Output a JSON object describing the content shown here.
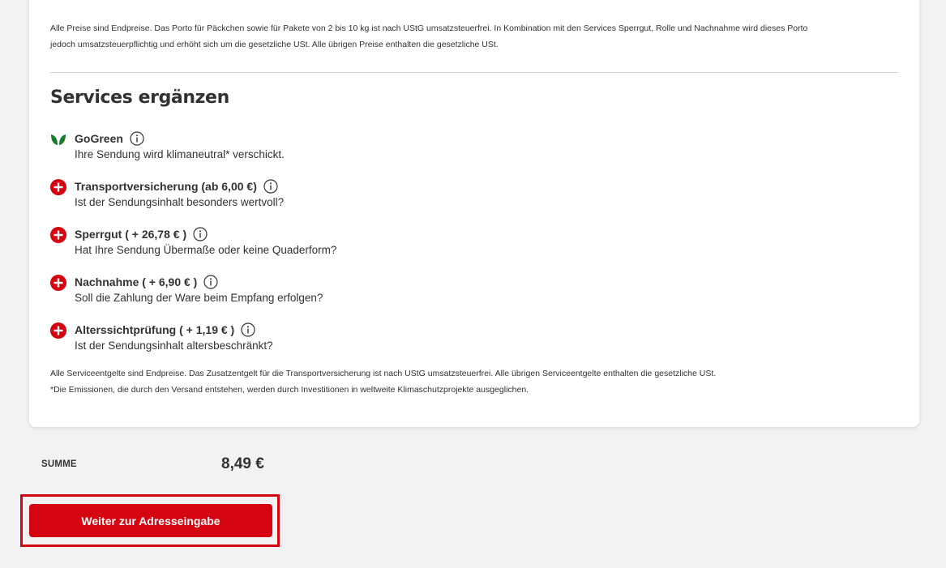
{
  "price_note": {
    "line1": "Alle Preise sind Endpreise. Das Porto für Päckchen sowie für Pakete von 2 bis 10 kg ist nach UStG umsatzsteuerfrei. In Kombination mit den Services Sperrgut, Rolle und Nachnahme wird dieses Porto",
    "line2": "jedoch umsatzsteuerpflichtig und erhöht sich um die gesetzliche USt. Alle übrigen Preise enthalten die gesetzliche USt."
  },
  "services": {
    "title": "Services ergänzen",
    "items": [
      {
        "name": "GoGreen",
        "description": "Ihre Sendung wird klimaneutral* verschickt.",
        "icon": "leaf-icon"
      },
      {
        "name": "Transportversicherung (ab 6,00 €)",
        "description": "Ist der Sendungsinhalt besonders wertvoll?",
        "icon": "plus-icon"
      },
      {
        "name": "Sperrgut ( + 26,78 € )",
        "description": "Hat Ihre Sendung Übermaße oder keine Quaderform?",
        "icon": "plus-icon"
      },
      {
        "name": "Nachnahme ( + 6,90 € )",
        "description": "Soll die Zahlung der Ware beim Empfang erfolgen?",
        "icon": "plus-icon"
      },
      {
        "name": "Alterssichtprüfung ( + 1,19 € )",
        "description": "Ist der Sendungsinhalt altersbeschränkt?",
        "icon": "plus-icon"
      }
    ],
    "footnote1": "Alle Serviceentgelte sind Endpreise. Das Zusatzentgelt für die Transportversicherung ist nach UStG umsatzsteuerfrei. Alle übrigen Serviceentgelte enthalten die gesetzliche USt.",
    "footnote2": "*Die Emissionen, die durch den Versand entstehen, werden durch Investitionen in weltweite Klimaschutzprojekte ausgeglichen."
  },
  "summary": {
    "label": "SUMME",
    "value": "8,49 €"
  },
  "cta": {
    "label": "Weiter zur Adresseingabe"
  },
  "colors": {
    "brand_red": "#d40511",
    "gogreen": "#1a7a2e",
    "text": "#323232",
    "background": "#f2f2f2"
  }
}
